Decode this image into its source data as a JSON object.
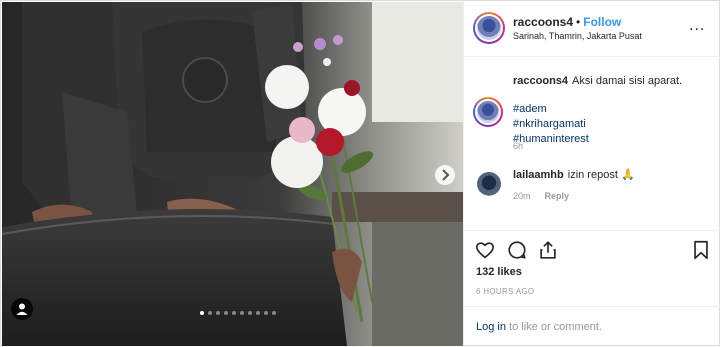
{
  "post": {
    "username": "raccoons4",
    "separator": "•",
    "follow_label": "Follow",
    "location": "Sarinah, Thamrin, Jakarta Pusat",
    "more_label": "..."
  },
  "caption": {
    "username": "raccoons4",
    "text": "Aksi damai sisi aparat.",
    "hashtags": [
      "#adem",
      "#nkrihargamati",
      "#humaninterest"
    ],
    "time": "6h"
  },
  "comment": {
    "username": "lailaamhb",
    "text": "izin repost 🙏",
    "time": "20m",
    "reply_label": "Reply"
  },
  "engagement": {
    "likes": "132 likes",
    "posted_ago": "6 HOURS AGO"
  },
  "footer": {
    "login_link": "Log in",
    "login_rest": " to like or comment."
  },
  "carousel": {
    "slide_count": 10,
    "active_index": 0
  },
  "colors": {
    "accent": "#3897f0",
    "link": "#003569",
    "muted": "#999999"
  },
  "icons": [
    "heart-icon",
    "comment-icon",
    "share-icon",
    "bookmark-icon",
    "chevron-right-icon",
    "user-tag-icon"
  ]
}
